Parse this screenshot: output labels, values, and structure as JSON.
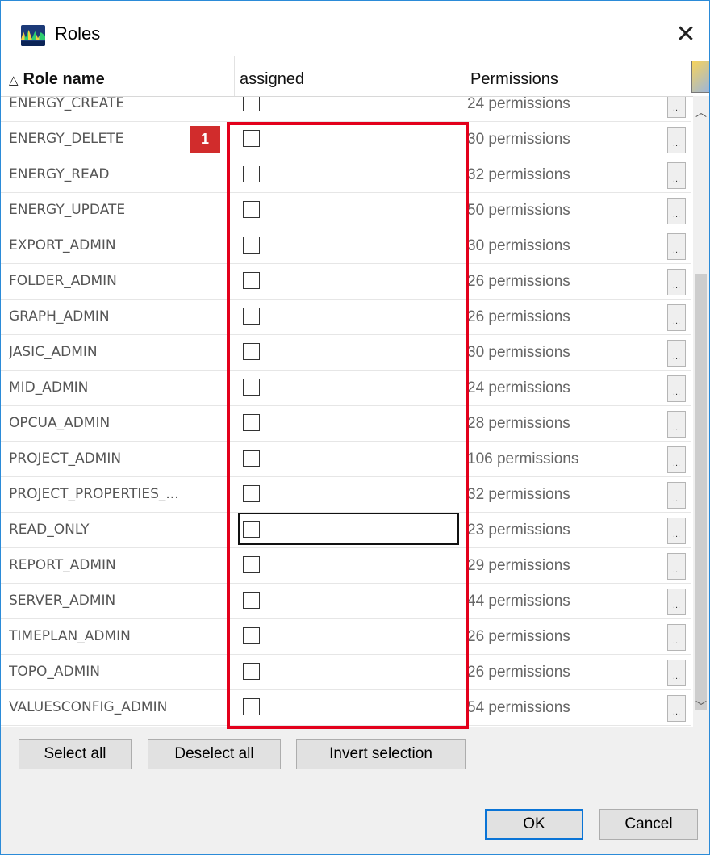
{
  "window": {
    "title": "Roles",
    "close_glyph": "✕",
    "app_icon": "app-logo-icon"
  },
  "table": {
    "columns": {
      "role_name": "Role name",
      "assigned": "assigned",
      "permissions": "Permissions"
    },
    "sort_indicator": "△",
    "rows": [
      {
        "name": "ENERGY_CREATE",
        "assigned": false,
        "permissions": "24 permissions"
      },
      {
        "name": "ENERGY_DELETE",
        "assigned": false,
        "permissions": "30 permissions"
      },
      {
        "name": "ENERGY_READ",
        "assigned": false,
        "permissions": "32 permissions"
      },
      {
        "name": "ENERGY_UPDATE",
        "assigned": false,
        "permissions": "50 permissions"
      },
      {
        "name": "EXPORT_ADMIN",
        "assigned": false,
        "permissions": "30 permissions"
      },
      {
        "name": "FOLDER_ADMIN",
        "assigned": false,
        "permissions": "26 permissions"
      },
      {
        "name": "GRAPH_ADMIN",
        "assigned": false,
        "permissions": "26 permissions"
      },
      {
        "name": "JASIC_ADMIN",
        "assigned": false,
        "permissions": "30 permissions"
      },
      {
        "name": "MID_ADMIN",
        "assigned": false,
        "permissions": "24 permissions"
      },
      {
        "name": "OPCUA_ADMIN",
        "assigned": false,
        "permissions": "28 permissions"
      },
      {
        "name": "PROJECT_ADMIN",
        "assigned": false,
        "permissions": "106 permissions"
      },
      {
        "name": "PROJECT_PROPERTIES_...",
        "assigned": false,
        "permissions": "32 permissions"
      },
      {
        "name": "READ_ONLY",
        "assigned": false,
        "permissions": "23 permissions",
        "focused": true
      },
      {
        "name": "REPORT_ADMIN",
        "assigned": false,
        "permissions": "29 permissions"
      },
      {
        "name": "SERVER_ADMIN",
        "assigned": false,
        "permissions": "44 permissions"
      },
      {
        "name": "TIMEPLAN_ADMIN",
        "assigned": false,
        "permissions": "26 permissions"
      },
      {
        "name": "TOPO_ADMIN",
        "assigned": false,
        "permissions": "26 permissions"
      },
      {
        "name": "VALUESCONFIG_ADMIN",
        "assigned": false,
        "permissions": "54 permissions"
      }
    ],
    "details_label": "..."
  },
  "annotation": {
    "badge": "1",
    "color": "#e3001b"
  },
  "buttons": {
    "select_all": "Select all",
    "deselect_all": "Deselect all",
    "invert_selection": "Invert selection",
    "ok": "OK",
    "cancel": "Cancel"
  }
}
